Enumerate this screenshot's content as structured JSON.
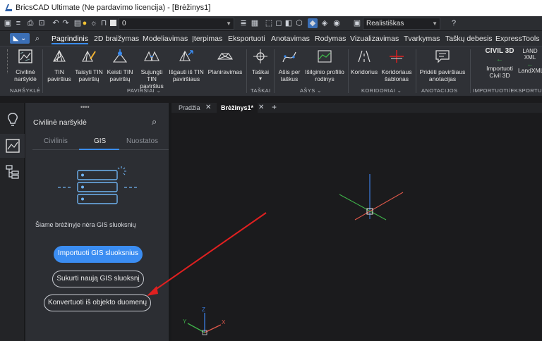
{
  "titlebar": {
    "title": "BricsCAD Ultimate (Ne pardavimo licencija) - [Brėžinys1]"
  },
  "qat": {
    "layer_value": "0",
    "visual_style": "Realistiškas"
  },
  "ribbon": {
    "tabs": [
      "Pagrindinis",
      "2D braižymas",
      "Modeliavimas",
      "Įterpimas",
      "Eksportuoti",
      "Anotavimas",
      "Rodymas",
      "Vizualizavimas",
      "Tvarkymas",
      "Taškų debesis",
      "ExpressTools"
    ],
    "active_tab": "Pagrindinis",
    "buttons": {
      "civil_browser": "Civilinė naršyklė",
      "tin_surfaces": "TIN paviršius",
      "fix_tin": "Taisyti TIN paviršių",
      "edit_tin": "Keisti TIN paviršių",
      "merge_tin": "Sujungti TIN paviršius",
      "extract_tin": "Išgauti iš TIN paviršiaus",
      "grading": "Planiravimas",
      "points": "Taškai",
      "axis_from_points": "Ašis per taškus",
      "profile_view": "Išilginio profilio rodinys",
      "corridors": "Koridorius",
      "corridor_templates": "Koridoriaus šablonas",
      "add_surface_annotations": "Pridėti paviršiaus anotacijas",
      "import_civil3d": "Importuoti Civil 3D",
      "civil3d_label": "CIVIL 3D",
      "landxml": "LandXML",
      "land_label": "LAND",
      "xml_label": "XML"
    },
    "groups": {
      "browser": "NARŠYKLĖ",
      "surfaces": "PAVIRŠIAI",
      "points": "TAŠKAI",
      "axes": "AŠYS",
      "corridors": "KORIDORIAI",
      "annotations": "ANOTACIJOS",
      "import_export": "IMPORTUOTI/EKSPORTUOTI"
    }
  },
  "panel": {
    "title": "Civilinė naršyklė",
    "tabs": [
      "Civilinis",
      "GIS",
      "Nuostatos"
    ],
    "active_tab": "GIS",
    "empty_message": "Šiame brėžinyje nėra GIS sluoksnių",
    "import_button": "Importuoti GIS sluoksnius",
    "create_button": "Sukurti naują GIS sluoksnį",
    "convert_button": "Konvertuoti iš objekto duomenų"
  },
  "documents": {
    "tabs": [
      "Pradžia",
      "Brėžinys1*"
    ],
    "active": "Brėžinys1*"
  },
  "ucs": {
    "x_label": "X",
    "y_label": "Y",
    "z_label": "Z"
  },
  "colors": {
    "accent": "#3b8df2",
    "arrow": "#e02020",
    "x_axis": "#e0584a",
    "y_axis": "#3fb34a",
    "z_axis": "#3b7de0"
  }
}
